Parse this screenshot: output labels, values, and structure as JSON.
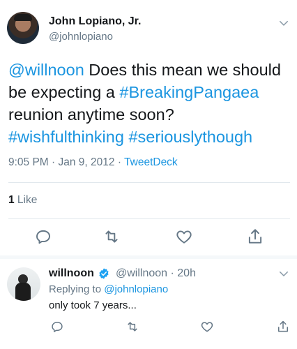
{
  "main_tweet": {
    "author_name": "John Lopiano, Jr.",
    "author_handle": "@johnlopiano",
    "text": {
      "mention": "@willnoon",
      "line1_rest": " Does this mean we should",
      "line2_start": "be expecting a ",
      "hashtag1": "#BreakingPangaea",
      "line3": "reunion anytime soon?",
      "hashtag2": "#wishfulthinking",
      "space": " ",
      "hashtag3": "#seriouslythough"
    },
    "timestamp": "9:05 PM · Jan 9, 2012 · ",
    "source": "TweetDeck",
    "like_count": "1",
    "like_label": " Like"
  },
  "reply_tweet": {
    "author_name": "willnoon",
    "author_handle": "@willnoon · 20h",
    "replying_label": "Replying to ",
    "replying_to": "@johnlopiano",
    "text": "only took 7 years..."
  },
  "icons": {
    "more": "chevron-down-icon",
    "reply": "reply-icon",
    "retweet": "retweet-icon",
    "like": "heart-icon",
    "share": "share-icon",
    "verified": "verified-badge-icon"
  },
  "colors": {
    "link": "#1b95e0",
    "muted": "#657786",
    "text": "#14171a",
    "divider": "#e1e8ed"
  }
}
